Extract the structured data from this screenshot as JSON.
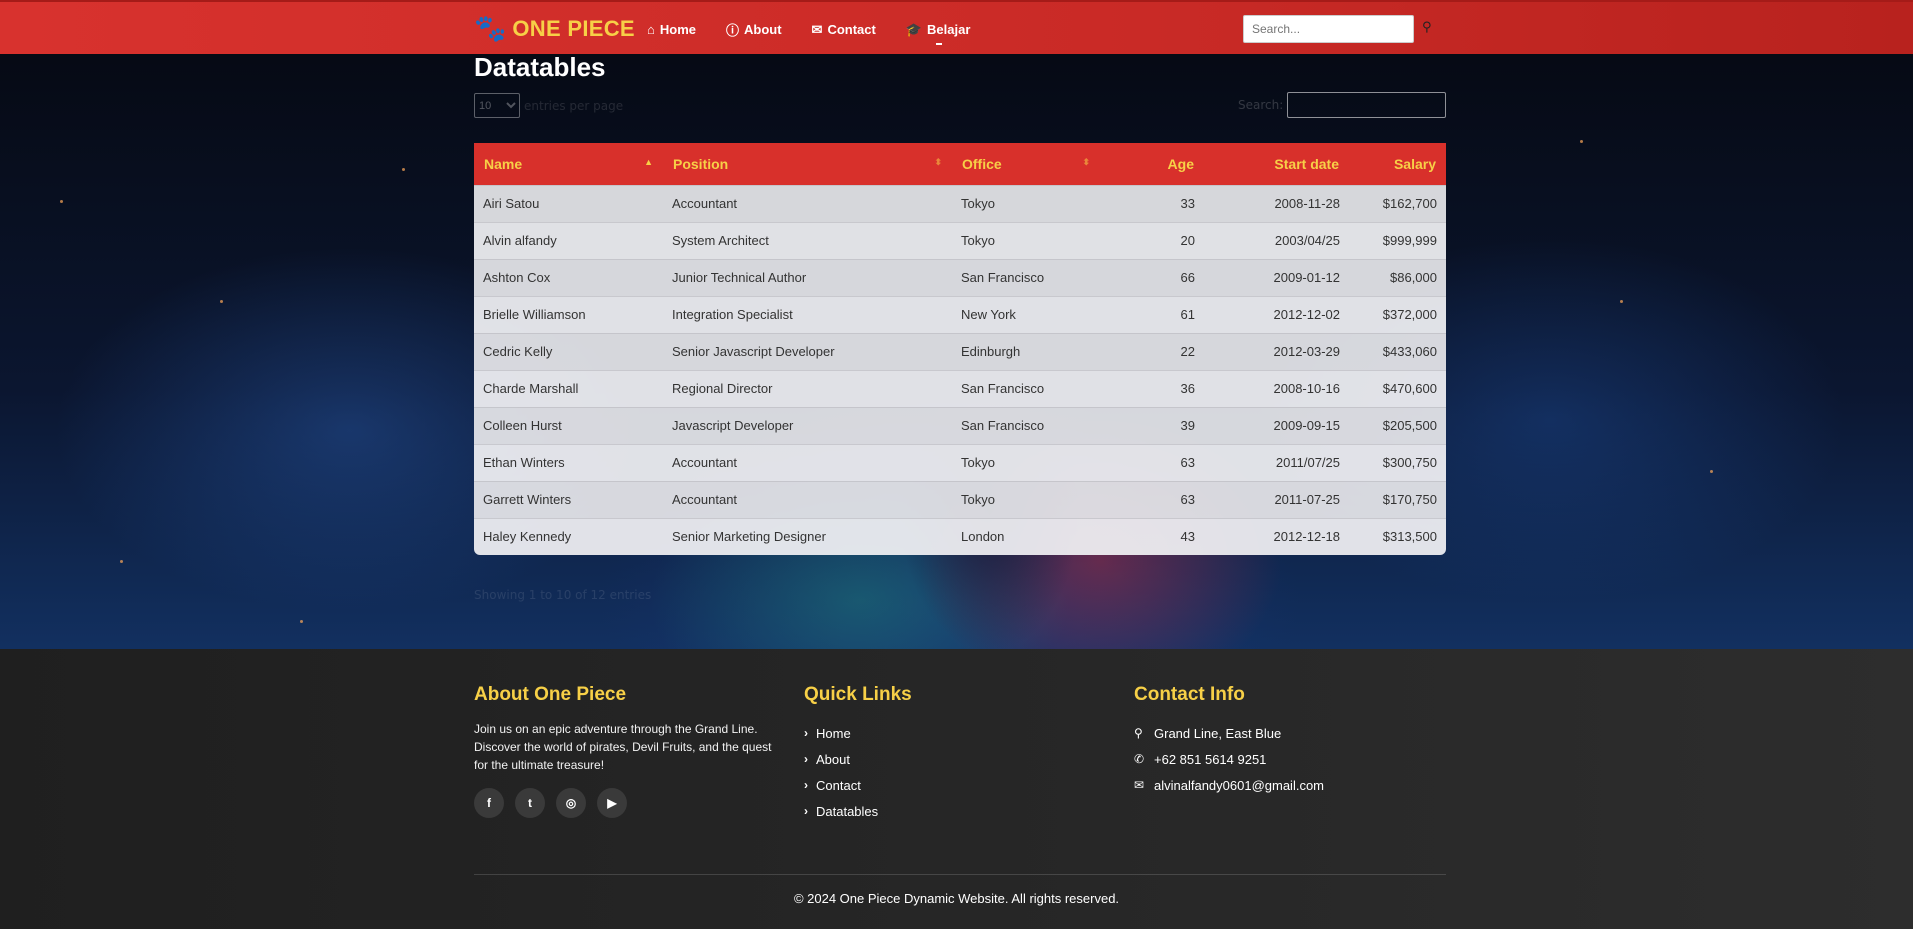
{
  "nav": {
    "brand": "ONE PIECE",
    "brand_icon": "paw-icon",
    "links": [
      {
        "label": "Home",
        "icon": "home-icon"
      },
      {
        "label": "About",
        "icon": "info-icon"
      },
      {
        "label": "Contact",
        "icon": "envelope-icon"
      },
      {
        "label": "Belajar",
        "icon": "graduation-cap-icon"
      }
    ],
    "search_placeholder": "Search..."
  },
  "page": {
    "title": "Datatables",
    "length_value": "10",
    "length_label": "entries per page",
    "search_label": "Search:",
    "info": "Showing 1 to 10 of 12 entries"
  },
  "table": {
    "headers": [
      "Name",
      "Position",
      "Office",
      "Age",
      "Start date",
      "Salary"
    ],
    "rows": [
      [
        "Airi Satou",
        "Accountant",
        "Tokyo",
        "33",
        "2008-11-28",
        "$162,700"
      ],
      [
        "Alvin alfandy",
        "System Architect",
        "Tokyo",
        "20",
        "2003/04/25",
        "$999,999"
      ],
      [
        "Ashton Cox",
        "Junior Technical Author",
        "San Francisco",
        "66",
        "2009-01-12",
        "$86,000"
      ],
      [
        "Brielle Williamson",
        "Integration Specialist",
        "New York",
        "61",
        "2012-12-02",
        "$372,000"
      ],
      [
        "Cedric Kelly",
        "Senior Javascript Developer",
        "Edinburgh",
        "22",
        "2012-03-29",
        "$433,060"
      ],
      [
        "Charde Marshall",
        "Regional Director",
        "San Francisco",
        "36",
        "2008-10-16",
        "$470,600"
      ],
      [
        "Colleen Hurst",
        "Javascript Developer",
        "San Francisco",
        "39",
        "2009-09-15",
        "$205,500"
      ],
      [
        "Ethan Winters",
        "Accountant",
        "Tokyo",
        "63",
        "2011/07/25",
        "$300,750"
      ],
      [
        "Garrett Winters",
        "Accountant",
        "Tokyo",
        "63",
        "2011-07-25",
        "$170,750"
      ],
      [
        "Haley Kennedy",
        "Senior Marketing Designer",
        "London",
        "43",
        "2012-12-18",
        "$313,500"
      ]
    ]
  },
  "footer": {
    "about_title": "About One Piece",
    "about_text": "Join us on an epic adventure through the Grand Line. Discover the world of pirates, Devil Fruits, and the quest for the ultimate treasure!",
    "socials": [
      "facebook-icon",
      "twitter-icon",
      "instagram-icon",
      "youtube-icon"
    ],
    "links_title": "Quick Links",
    "links": [
      "Home",
      "About",
      "Contact",
      "Datatables"
    ],
    "contact_title": "Contact Info",
    "contacts": [
      {
        "icon": "map-pin-icon",
        "text": "Grand Line, East Blue"
      },
      {
        "icon": "phone-icon",
        "text": "+62 851 5614 9251"
      },
      {
        "icon": "envelope-icon",
        "text": "alvinalfandy0601@gmail.com"
      }
    ],
    "copyright": "© 2024 One Piece Dynamic Website. All rights reserved."
  }
}
